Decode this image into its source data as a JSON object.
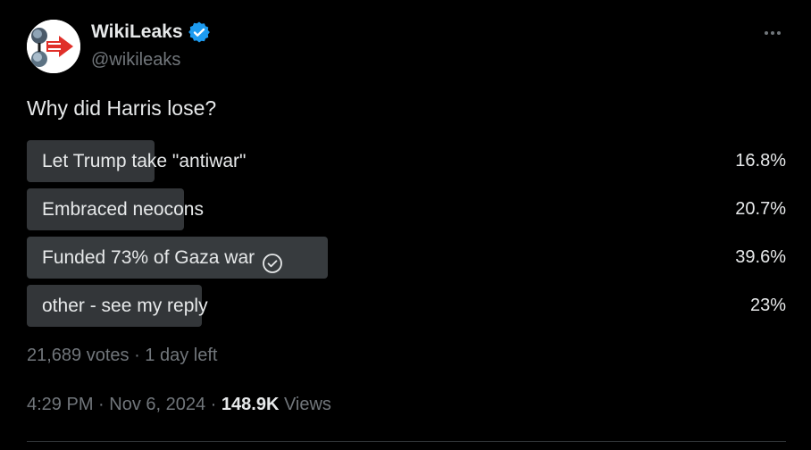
{
  "author": {
    "display_name": "WikiLeaks",
    "handle": "@wikileaks",
    "verified": true,
    "verified_color": "#1d9bf0"
  },
  "question": "Why did Harris lose?",
  "poll": {
    "options": [
      {
        "label": "Let Trump take \"antiwar\"",
        "percent": "16.8%",
        "fraction": 0.168,
        "winner": false
      },
      {
        "label": "Embraced neocons",
        "percent": "20.7%",
        "fraction": 0.207,
        "winner": false
      },
      {
        "label": "Funded 73% of Gaza war",
        "percent": "39.6%",
        "fraction": 0.396,
        "winner": true
      },
      {
        "label": "other - see my reply",
        "percent": "23%",
        "fraction": 0.23,
        "winner": false
      }
    ],
    "meta": "21,689 votes · 1 day left"
  },
  "footer": {
    "time": "4:29 PM · Nov 6, 2024 · ",
    "views_count": "148.9K",
    "views_label": " Views"
  },
  "icons": {
    "more": "more-icon",
    "verified": "verified-badge-icon",
    "check": "check-circle-icon"
  }
}
